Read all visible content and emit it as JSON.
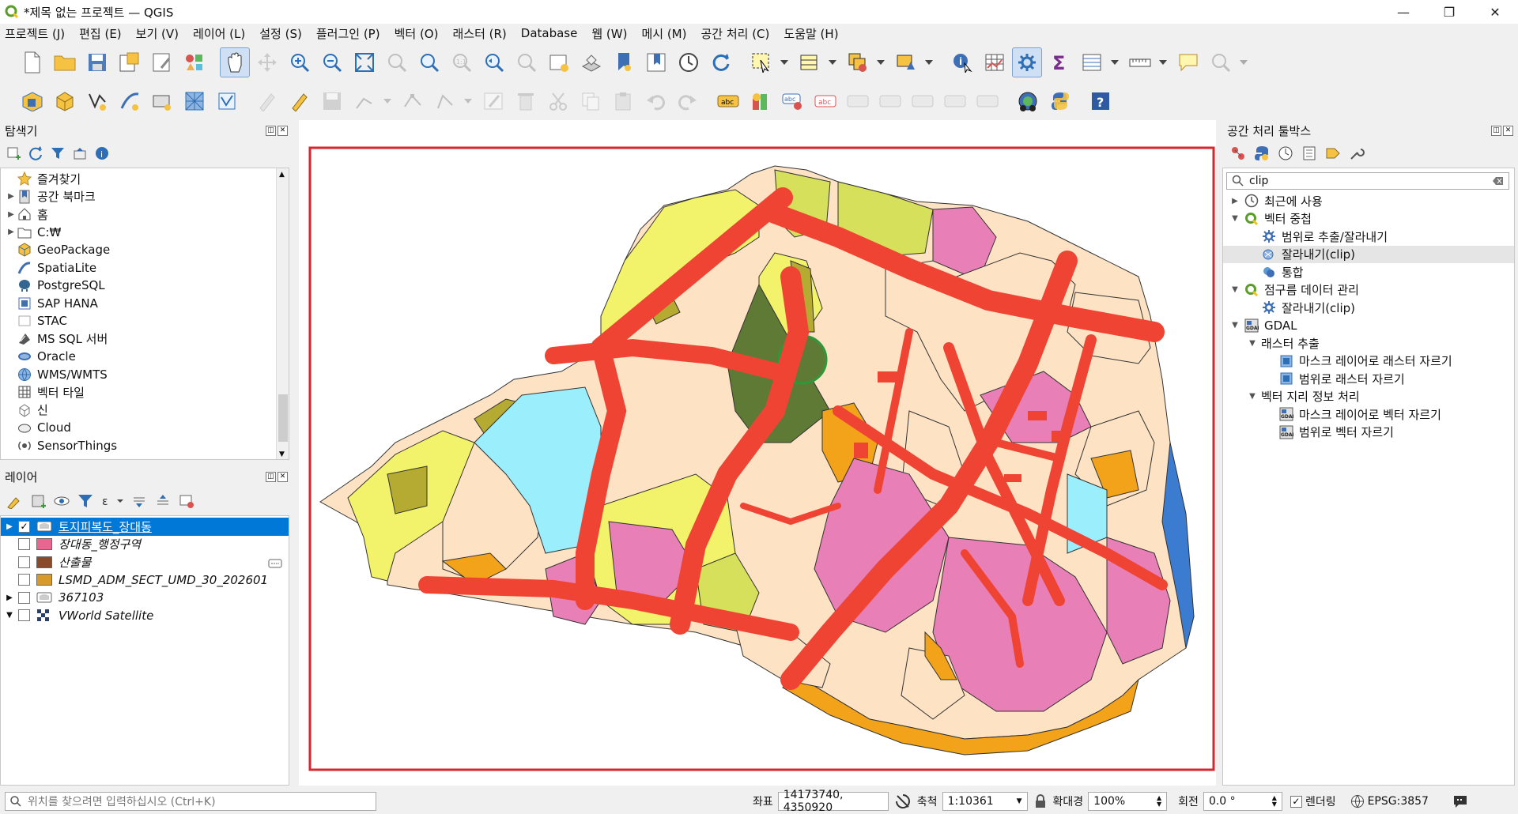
{
  "window": {
    "title": "*제목 없는 프로젝트 — QGIS",
    "minimize": "—",
    "maximize": "❐",
    "close": "✕"
  },
  "menu": [
    "프로젝트 (J)",
    "편집 (E)",
    "보기 (V)",
    "레이어 (L)",
    "설정 (S)",
    "플러그인 (P)",
    "벡터 (O)",
    "래스터 (R)",
    "Database",
    "웹 (W)",
    "메시 (M)",
    "공간 처리 (C)",
    "도움말 (H)"
  ],
  "browser": {
    "title": "탐색기",
    "items": [
      {
        "label": "즐겨찾기",
        "icon": "star-icon",
        "arrow": ""
      },
      {
        "label": "공간 북마크",
        "icon": "bookmark-icon",
        "arrow": "▶"
      },
      {
        "label": "홈",
        "icon": "home-icon",
        "arrow": "▶"
      },
      {
        "label": "C:₩",
        "icon": "folder-icon",
        "arrow": "▶"
      },
      {
        "label": "GeoPackage",
        "icon": "geopackage-icon",
        "arrow": ""
      },
      {
        "label": "SpatiaLite",
        "icon": "spatialite-icon",
        "arrow": ""
      },
      {
        "label": "PostgreSQL",
        "icon": "postgresql-icon",
        "arrow": ""
      },
      {
        "label": "SAP HANA",
        "icon": "sap-hana-icon",
        "arrow": ""
      },
      {
        "label": "STAC",
        "icon": "stac-icon",
        "arrow": ""
      },
      {
        "label": "MS SQL 서버",
        "icon": "mssql-icon",
        "arrow": ""
      },
      {
        "label": "Oracle",
        "icon": "oracle-icon",
        "arrow": ""
      },
      {
        "label": "WMS/WMTS",
        "icon": "globe-icon",
        "arrow": ""
      },
      {
        "label": "벡터 타일",
        "icon": "vector-tile-icon",
        "arrow": ""
      },
      {
        "label": "신",
        "icon": "scene-icon",
        "arrow": ""
      },
      {
        "label": "Cloud",
        "icon": "cloud-icon",
        "arrow": ""
      },
      {
        "label": "SensorThings",
        "icon": "sensorthings-icon",
        "arrow": ""
      }
    ]
  },
  "layers_panel": {
    "title": "레이어",
    "layers": [
      {
        "label": "토지피복도_장대동",
        "checked": "✓",
        "swatch": "",
        "style": "sel ul",
        "arrow": "▶"
      },
      {
        "label": "장대동_행정구역",
        "checked": "",
        "swatch": "#e8668f",
        "style": "it",
        "arrow": ""
      },
      {
        "label": "산출물",
        "checked": "",
        "swatch": "#8b4a2b",
        "style": "it",
        "arrow": ""
      },
      {
        "label": "LSMD_ADM_SECT_UMD_30_202601",
        "checked": "",
        "swatch": "#d79a2a",
        "style": "it",
        "arrow": ""
      },
      {
        "label": "367103",
        "checked": "",
        "swatch": "",
        "style": "it",
        "arrow": "▶"
      },
      {
        "label": "VWorld Satellite",
        "checked": "",
        "swatch": "",
        "style": "it",
        "arrow": "▼"
      }
    ]
  },
  "processing": {
    "title": "공간 처리 툴박스",
    "search_value": "clip",
    "items": [
      {
        "label": "최근에 사용",
        "indent": 0,
        "arrow": "▶",
        "icon": "clock-icon",
        "selected": false
      },
      {
        "label": "벡터 중첩",
        "indent": 0,
        "arrow": "▼",
        "icon": "qgis-icon",
        "selected": false
      },
      {
        "label": "범위로 추출/잘라내기",
        "indent": 1,
        "arrow": "",
        "icon": "gear-icon",
        "selected": false
      },
      {
        "label": "잘라내기(clip)",
        "indent": 1,
        "arrow": "",
        "icon": "clip-icon",
        "selected": true
      },
      {
        "label": "통합",
        "indent": 1,
        "arrow": "",
        "icon": "union-icon",
        "selected": false
      },
      {
        "label": "점구름 데이터 관리",
        "indent": 0,
        "arrow": "▼",
        "icon": "qgis-icon",
        "selected": false
      },
      {
        "label": "잘라내기(clip)",
        "indent": 1,
        "arrow": "",
        "icon": "gear-icon",
        "selected": false
      },
      {
        "label": "GDAL",
        "indent": 0,
        "arrow": "▼",
        "icon": "gdal-icon",
        "selected": false
      },
      {
        "label": "래스터 추출",
        "indent": 1,
        "arrow": "▼",
        "icon": "",
        "selected": false
      },
      {
        "label": "마스크 레이어로 래스터 자르기",
        "indent": 2,
        "arrow": "",
        "icon": "raster-clip-icon",
        "selected": false
      },
      {
        "label": "범위로 래스터 자르기",
        "indent": 2,
        "arrow": "",
        "icon": "raster-clip-icon",
        "selected": false
      },
      {
        "label": "벡터 지리 정보 처리",
        "indent": 1,
        "arrow": "▼",
        "icon": "",
        "selected": false
      },
      {
        "label": "마스크 레이어로 벡터 자르기",
        "indent": 2,
        "arrow": "",
        "icon": "gdal-icon",
        "selected": false
      },
      {
        "label": "범위로 벡터 자르기",
        "indent": 2,
        "arrow": "",
        "icon": "gdal-icon",
        "selected": false
      }
    ]
  },
  "status": {
    "locator_placeholder": "위치를 찾으려면 입력하십시오 (Ctrl+K)",
    "coord_label": "좌표",
    "coord_value": "14173740, 4350920",
    "scale_label": "축척",
    "scale_value": "1:10361",
    "magnifier_label": "확대경",
    "magnifier_value": "100%",
    "rotation_label": "회전",
    "rotation_value": "0.0 °",
    "render_label": "렌더링",
    "crs": "EPSG:3857"
  },
  "colors": {
    "accent": "#0078d7",
    "map_frame": "#d7262e",
    "road": "#ef4434",
    "forest": "#5f7a35",
    "urban": "#fde2c4",
    "commercial": "#e97fb7",
    "agri": "#f3f36b",
    "water": "#9beefc"
  }
}
